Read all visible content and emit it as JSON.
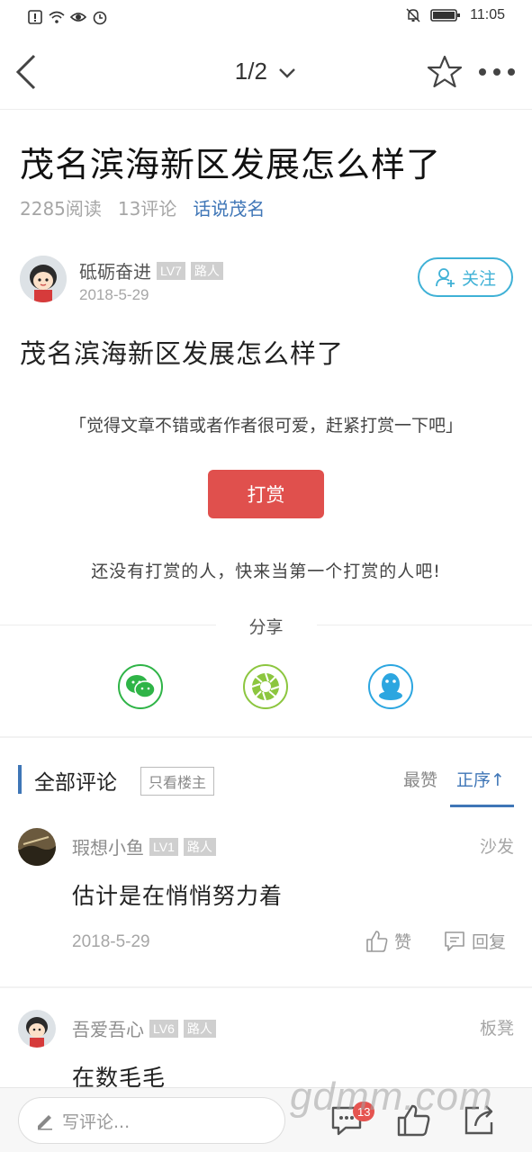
{
  "status_bar": {
    "time": "11:05",
    "left_icons": [
      "alert-icon",
      "wifi-icon",
      "eye-icon",
      "alarm-icon"
    ],
    "right_icons": [
      "mute-icon",
      "battery-icon"
    ]
  },
  "nav": {
    "page_indicator": "1/2",
    "icons": [
      "back-icon",
      "chevron-down-icon",
      "star-icon",
      "more-icon"
    ]
  },
  "article": {
    "title": "茂名滨海新区发展怎么样了",
    "reads": "2285阅读",
    "comments": "13评论",
    "topic": "话说茂名",
    "author": {
      "name": "砥砺奋进",
      "level": "LV7",
      "rank": "路人",
      "date": "2018-5-29",
      "follow_label": "关注"
    },
    "body": "茂名滨海新区发展怎么样了",
    "reward_quote": "「觉得文章不错或者作者很可爱，赶紧打赏一下吧」",
    "reward_button": "打赏",
    "reward_none": "还没有打赏的人，快来当第一个打赏的人吧!"
  },
  "share": {
    "label": "分享",
    "items": [
      {
        "name": "wechat-icon",
        "color": "#2fb447"
      },
      {
        "name": "moments-icon",
        "color": "#8cc63f"
      },
      {
        "name": "qq-icon",
        "color": "#2ca6e0"
      }
    ]
  },
  "comments_header": {
    "title": "全部评论",
    "owner_only": "只看楼主",
    "sort_hot": "最赞",
    "sort_asc": "正序↑"
  },
  "comments": [
    {
      "user": "瑕想小鱼",
      "level": "LV1",
      "rank": "路人",
      "floor": "沙发",
      "text": "估计是在悄悄努力着",
      "date": "2018-5-29",
      "like_label": "赞",
      "reply_label": "回复"
    },
    {
      "user": "吾爱吾心",
      "level": "LV6",
      "rank": "路人",
      "floor": "板凳",
      "text": "在数毛毛"
    }
  ],
  "bottom_bar": {
    "write_placeholder": "写评论...",
    "comment_count": "13",
    "watermark": "gdmm.com"
  },
  "colors": {
    "accent_blue": "#3f76b7",
    "follow_cyan": "#3fb1d6",
    "reward_red": "#e0504d",
    "badge_red": "#e55450"
  }
}
